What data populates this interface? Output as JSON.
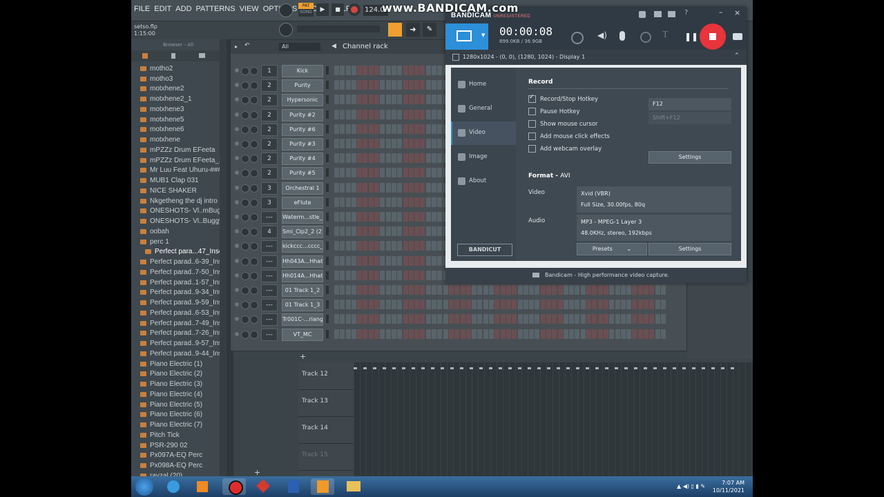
{
  "watermark": "www.BANDICAM.com",
  "fl": {
    "menus": [
      "FILE",
      "EDIT",
      "ADD",
      "PATTERNS",
      "VIEW",
      "OPTIONS",
      "TOOLS",
      "HELP"
    ],
    "project_file": "setso.flp",
    "time": "1:15:00",
    "tempo": "124.0",
    "pat_label": "PAT",
    "song_label": "SONG"
  },
  "browser": {
    "title": "Browser - All",
    "items": [
      "motho2",
      "motho3",
      "motxhene2",
      "motxhene2_1",
      "motxhene3",
      "motxhene5",
      "motxhene6",
      "motxhene",
      "mPZZz Drum EFeeta",
      "mPZZz Drum EFeeta_2",
      "Mr Luu Feat Uhuru-####_4",
      "MUB1 Clap 031",
      "NICE SHAKER",
      "Nkgetheng the dj intro",
      "ONESHOTS- Vl..mBuggy) (9)",
      "ONESHOTS- Vl..Buggy) (25)",
      "oobah",
      "perc 1",
      "Perfect para...47_Insert 2",
      "Perfect parad..6-39_Insert 2",
      "Perfect parad..7-50_Insert 2",
      "Perfect parad..1-57_Insert 2",
      "Perfect parad..9-34_Insert 2",
      "Perfect parad..9-59_Insert 2",
      "Perfect parad..6-53_Insert 3",
      "Perfect parad..7-49_Insert 3",
      "Perfect parad..7-26_Insert 4",
      "Perfect parad..9-57_Insert 4",
      "Perfect parad..9-44_Insert 5",
      "Piano Electric (1)",
      "Piano Electric (2)",
      "Piano Electric (3)",
      "Piano Electric (4)",
      "Piano Electric (5)",
      "Piano Electric (6)",
      "Piano Electric (7)",
      "Pitch Tick",
      "PSR-290 02",
      "Px097A-EQ Perc",
      "Px098A-EQ Perc",
      "rayzal (20)"
    ],
    "selected_index": 18
  },
  "rack": {
    "title": "Channel rack",
    "filter": "All",
    "add_label": "+",
    "channels": [
      {
        "num": "1",
        "name": "Kick"
      },
      {
        "num": "2",
        "name": "Purity"
      },
      {
        "num": "2",
        "name": "Hypersonic"
      },
      {
        "num": "2",
        "name": "Purity #2"
      },
      {
        "num": "2",
        "name": "Purity #6"
      },
      {
        "num": "2",
        "name": "Purity #3"
      },
      {
        "num": "2",
        "name": "Purity #4"
      },
      {
        "num": "2",
        "name": "Purity #5"
      },
      {
        "num": "3",
        "name": "Orchestral 1"
      },
      {
        "num": "3",
        "name": "eFlute"
      },
      {
        "num": "---",
        "name": "Waterm...stle_2"
      },
      {
        "num": "4",
        "name": "Smi_Clp2_2 (2)"
      },
      {
        "num": "---",
        "name": "kickccc...cccc_2"
      },
      {
        "num": "---",
        "name": "Hh043A...Hhat1"
      },
      {
        "num": "---",
        "name": "Hh014A...Hhat1"
      },
      {
        "num": "---",
        "name": "01 Track 1_2"
      },
      {
        "num": "---",
        "name": "01 Track 1_3"
      },
      {
        "num": "---",
        "name": "Tr001C-...riangle"
      },
      {
        "num": "---",
        "name": "VT_MC"
      }
    ]
  },
  "playlist": {
    "tracks": [
      "Track 12",
      "Track 13",
      "Track 14",
      "Track 15"
    ],
    "add_label": "+"
  },
  "bandicam": {
    "brand": "BANDICAM",
    "unregistered": "UNREGISTERED",
    "timer": "00:00:08",
    "filesize": "899.0KB / 36.9GB",
    "display_info": "1280x1024 - (0, 0), (1280, 1024) - Display 1",
    "nav": [
      "Home",
      "General",
      "Video",
      "Image",
      "About"
    ],
    "active_nav": 2,
    "record_heading": "Record",
    "options": [
      {
        "label": "Record/Stop Hotkey",
        "checked": true
      },
      {
        "label": "Pause Hotkey",
        "checked": false
      },
      {
        "label": "Show mouse cursor",
        "checked": false
      },
      {
        "label": "Add mouse click effects",
        "checked": false
      },
      {
        "label": "Add webcam overlay",
        "checked": false
      }
    ],
    "hotkey_record": "F12",
    "hotkey_pause": "Shift+F12",
    "settings_label": "Settings",
    "format_heading": "Format",
    "format_value": "AVI",
    "video_label": "Video",
    "video_codec": "Xvid (VBR)",
    "video_detail": "Full Size, 30.00fps, 80q",
    "audio_label": "Audio",
    "audio_codec": "MP3 - MPEG-1 Layer 3",
    "audio_detail": "48.0KHz, stereo, 192kbps",
    "presets_label": "Presets",
    "bandicut": "BANDICUT",
    "footer": "Bandicam - High performance video capture."
  },
  "taskbar": {
    "time": "7:07 AM",
    "date": "10/11/2021"
  }
}
